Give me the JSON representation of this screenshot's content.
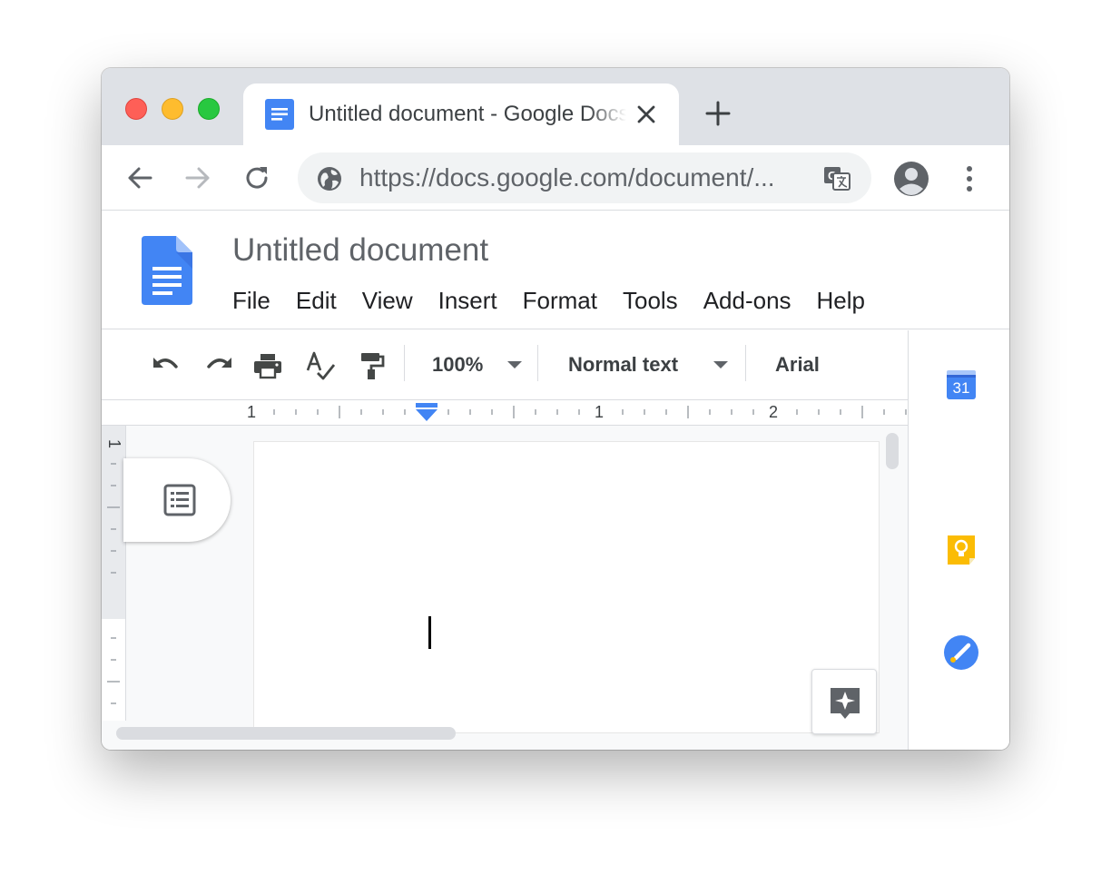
{
  "browser": {
    "tab": {
      "title": "Untitled document - Google Docs"
    },
    "omnibox": {
      "url": "https://docs.google.com/document/..."
    }
  },
  "docs": {
    "title": "Untitled document",
    "menu": [
      "File",
      "Edit",
      "View",
      "Insert",
      "Format",
      "Tools",
      "Add-ons",
      "Help"
    ],
    "toolbar": {
      "zoom": "100%",
      "style": "Normal text",
      "font": "Arial"
    },
    "ruler": {
      "horizontal_labels": [
        "1",
        "1",
        "2"
      ],
      "vertical_label": "1"
    }
  },
  "side_panel": {
    "calendar_day": "31"
  },
  "colors": {
    "docs_blue": "#4285f4",
    "keep_yellow": "#fbbc04",
    "tasks_blue": "#4285f4",
    "tab_strip": "#dee1e6"
  }
}
